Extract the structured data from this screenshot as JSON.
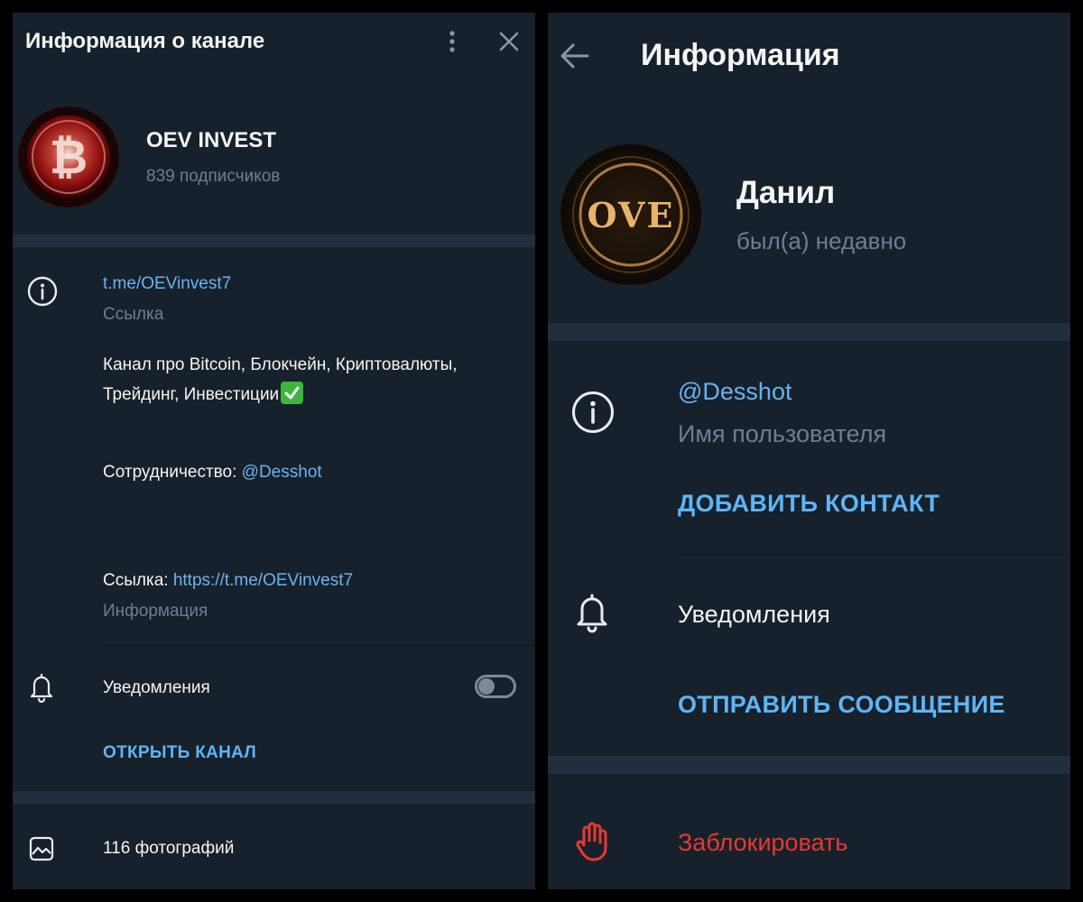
{
  "channel_info": {
    "header": {
      "title": "Информация о канале"
    },
    "channel": {
      "name": "OEV INVEST",
      "subscribers": "839 подписчиков"
    },
    "link": {
      "value": "t.me/OEVinvest7",
      "caption": "Ссылка"
    },
    "description": {
      "line1": "Канал про Bitcoin, Блокчейн, Криптовалюты,",
      "line2": "Трейдинг, Инвестиции",
      "line2_emoji": "✅",
      "cooperation_label": "Сотрудничество: ",
      "cooperation_handle": "@Desshot",
      "link_label": "Ссылка: ",
      "link_url": "https://t.me/OEVinvest7",
      "caption": "Информация"
    },
    "notifications": {
      "label": "Уведомления",
      "enabled": false
    },
    "open_channel_button": "ОТКРЫТЬ КАНАЛ",
    "media": {
      "photos": "116 фотографий"
    }
  },
  "user_info": {
    "header": {
      "title": "Информация"
    },
    "user": {
      "name": "Данил",
      "status": "был(а) недавно",
      "avatar_text": "OVE"
    },
    "username": {
      "value": "@Desshot",
      "caption": "Имя пользователя"
    },
    "add_contact_button": "ДОБАВИТЬ КОНТАКТ",
    "notifications": {
      "label": "Уведомления"
    },
    "send_message_button": "ОТПРАВИТЬ СООБЩЕНИЕ",
    "block_button": "Заблокировать"
  },
  "colors": {
    "panel_bg": "#17212b",
    "separator": "#232e3c",
    "link": "#6ab2f2",
    "accent_button": "#5eb5f7",
    "danger": "#e53935",
    "muted_text": "#6d7f8f"
  },
  "icons": {
    "info": "info-icon",
    "bell": "bell-icon",
    "photos": "image-icon",
    "more": "kebab-menu-icon",
    "close": "close-icon",
    "back": "arrow-left-icon",
    "block": "hand-stop-icon"
  }
}
